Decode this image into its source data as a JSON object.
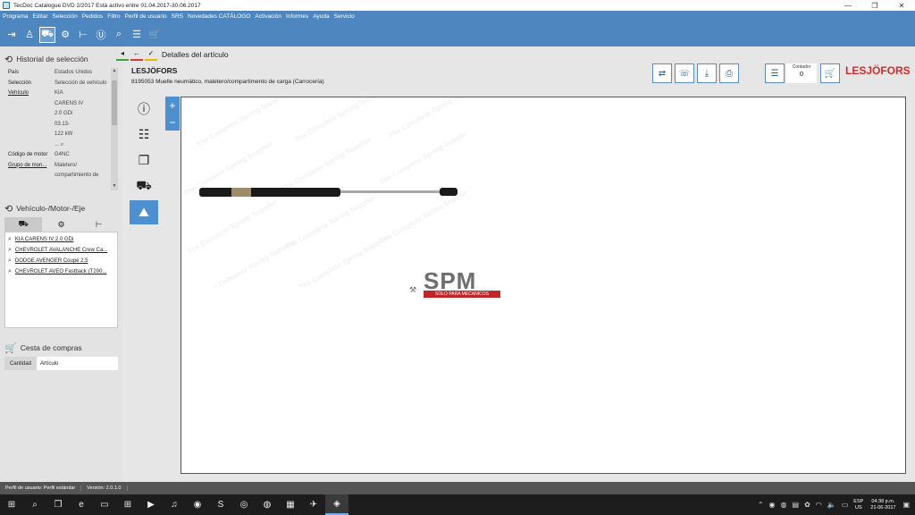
{
  "window": {
    "title": "TecDoc Catalogue DVD  2/2017 Está activo entre 01.04.2017-30.06.2017",
    "controls": [
      "—",
      "❐",
      "✕"
    ]
  },
  "menu": [
    "Programa",
    "Editar",
    "Selección",
    "Pedidos",
    "Filtro",
    "Perfil de usuario",
    "SRS",
    "Novedades CATÁLOGO",
    "Activación",
    "Informes",
    "Ayuda",
    "Servicio"
  ],
  "toolbar_icons": [
    "exit-icon",
    "user-icon",
    "vehicle-search-icon",
    "engine-icon",
    "axle-icon",
    "universal-icon",
    "search-icon",
    "list-icon",
    "cart-icon"
  ],
  "history": {
    "title": "Historial de selección",
    "rows": [
      {
        "k": "País",
        "v": "Estados Unidos",
        "u": false
      },
      {
        "k": "Selección",
        "v": "Selección de vehículo",
        "u": false
      },
      {
        "k": "Vehículo",
        "v": "KIA",
        "u": true
      },
      {
        "k": "",
        "v": "CARENS IV",
        "u": false
      },
      {
        "k": "",
        "v": "2.0 GDi",
        "u": false
      },
      {
        "k": "",
        "v": "03.13-",
        "u": false
      },
      {
        "k": "",
        "v": "122 kW",
        "u": false
      },
      {
        "k": "",
        "v": "...",
        "u": false
      },
      {
        "k": "Código de motor",
        "v": "G4NC",
        "u": false
      },
      {
        "k": "Grupo de mon...",
        "v": "Maletero/",
        "u": true
      },
      {
        "k": "",
        "v": "compartimiento de",
        "u": false
      }
    ]
  },
  "vehicles": {
    "title": "Vehículo-/Motor-/Eje",
    "items": [
      "KIA CARENS IV 2.0 GDi",
      "CHEVROLET AVALANCHE Crew Ca...",
      "DODGE AVENGER Coupé 2.5",
      "CHEVROLET AVEO Fastback (T200..."
    ]
  },
  "cart": {
    "title": "Cesta de compras",
    "col_qty": "Cantidad",
    "col_article": "Artículo"
  },
  "nav": {
    "title": "Detalles del artículo"
  },
  "article": {
    "brand": "LESJÖFORS",
    "description": "8195053 Muelle neumático, maletero/compartimento de carga (Carrocería)"
  },
  "counter": {
    "label": "Contador",
    "value": "0"
  },
  "brand_logo": "LESJÖFORS",
  "zoom": {
    "plus": "+",
    "minus": "−"
  },
  "image": {
    "watermark": "The Complete Spring Supplier",
    "logo_big": "SPM",
    "logo_small": "SOLO PARA MECANICOS"
  },
  "status": {
    "profile": "Perfil de usuario: Perfil estándar",
    "version": "Versión: 2.0.1.0"
  },
  "taskbar": {
    "lang": "ESP",
    "layout": "US",
    "time": "04:38 p.m.",
    "date": "21-06-2017"
  }
}
